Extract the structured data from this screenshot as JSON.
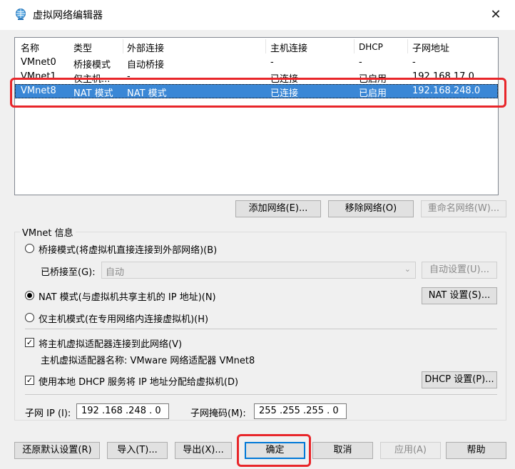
{
  "window": {
    "title": "虚拟网络编辑器",
    "close_glyph": "✕"
  },
  "table": {
    "headers": [
      "名称",
      "类型",
      "外部连接",
      "主机连接",
      "DHCP",
      "子网地址"
    ],
    "rows": [
      [
        "VMnet0",
        "桥接模式",
        "自动桥接",
        "-",
        "-",
        "-"
      ],
      [
        "VMnet1",
        "仅主机...",
        "-",
        "已连接",
        "已启用",
        "192.168.17.0"
      ],
      [
        "VMnet8",
        "NAT 模式",
        "NAT 模式",
        "已连接",
        "已启用",
        "192.168.248.0"
      ]
    ],
    "selected_index": 2
  },
  "list_buttons": {
    "add": "添加网络(E)...",
    "remove": "移除网络(O)",
    "rename": "重命名网络(W)..."
  },
  "vmnet_info": {
    "group_label": "VMnet 信息",
    "bridged_label": "桥接模式(将虚拟机直接连接到外部网络)(B)",
    "bridged_to_label": "已桥接至(G):",
    "bridged_to_value": "自动",
    "auto_settings": "自动设置(U)...",
    "nat_label": "NAT 模式(与虚拟机共享主机的 IP 地址)(N)",
    "nat_settings": "NAT 设置(S)...",
    "hostonly_label": "仅主机模式(在专用网络内连接虚拟机)(H)",
    "selected_mode": "nat",
    "connect_adapter_label": "将主机虚拟适配器连接到此网络(V)",
    "connect_adapter_checked": true,
    "adapter_name_label": "主机虚拟适配器名称: VMware 网络适配器 VMnet8",
    "dhcp_label": "使用本地 DHCP 服务将 IP 地址分配给虚拟机(D)",
    "dhcp_checked": true,
    "dhcp_settings": "DHCP 设置(P)...",
    "subnet_ip_label": "子网 IP (I):",
    "subnet_ip_value": "192 .168 .248 .  0",
    "subnet_mask_label": "子网掩码(M):",
    "subnet_mask_value": "255 .255 .255 .  0"
  },
  "footer": {
    "restore": "还原默认设置(R)",
    "import": "导入(T)...",
    "export": "导出(X)...",
    "ok": "确定",
    "cancel": "取消",
    "apply": "应用(A)",
    "help": "帮助"
  },
  "colors": {
    "selection": "#3a87d6",
    "highlight_box": "#e8262a",
    "default_button_border": "#0078d7"
  }
}
